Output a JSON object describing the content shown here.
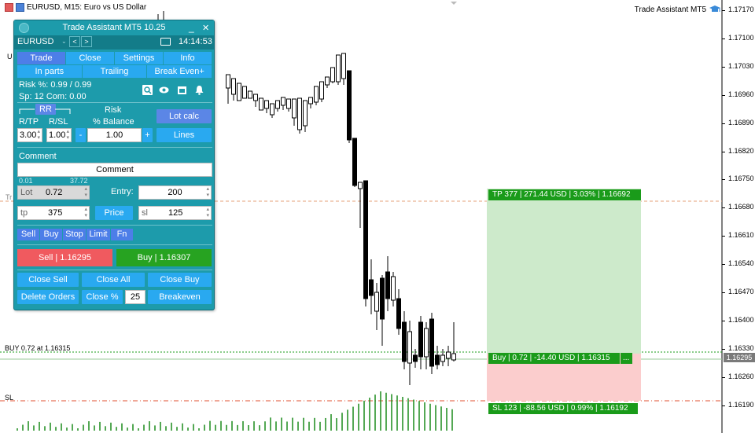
{
  "chart": {
    "symbol_title": "EURUSD, M15:  Euro vs US Dollar",
    "ea_name": "Trade Assistant MT5",
    "price_axis": [
      "1.17170",
      "1.17100",
      "1.17030",
      "1.16960",
      "1.16890",
      "1.16820",
      "1.16750",
      "1.16680",
      "1.16610",
      "1.16540",
      "1.16470",
      "1.16400",
      "1.16330",
      "1.16260",
      "1.16190"
    ],
    "current_price_tag": "1.16295",
    "buy_line_label": "BUY 0.72 at 1.16315",
    "sl_line_label": "SL",
    "tp_box_label": "TP 377 | 271.44 USD | 3.03% | 1.16692",
    "entry_box_label": "Buy | 0.72 | -14.40 USD | 1.16315",
    "entry_box_more": "...",
    "sl_box_label": "SL 123 | -88.56 USD | 0.99% | 1.16192",
    "left_marker_1": "U",
    "left_marker_2": "Tr",
    "colors": {
      "tp_zone": "#cdeacb",
      "sl_zone": "#fbcdcd",
      "label_bg": "#1a9b1a",
      "volume": "#1a8a1a",
      "grid": "#000000"
    }
  },
  "panel": {
    "title": "Trade Assistant MT5 10.25",
    "minimize": "_",
    "close": "✕",
    "symbol": "EURUSD",
    "symbol_dropdown": "⌄",
    "prev": "<",
    "next": ">",
    "time": "14:14:53",
    "tabs1": [
      "Trade",
      "Close",
      "Settings",
      "Info"
    ],
    "tabs2": [
      "In parts",
      "Trailing",
      "Break Even+"
    ],
    "risk_line": "Risk %: 0.99 /  0.99",
    "sp_line": "Sp: 12  Com: 0.00",
    "rr_label": "RR",
    "rtp_label": "R/TP",
    "rsl_label": "R/SL",
    "risk_label": "Risk",
    "balance_label": "% Balance",
    "lot_calc": "Lot calc",
    "rtp_value": "3.00",
    "rsl_value": "1.00",
    "minus": "-",
    "plus": "+",
    "risk_value": "1.00",
    "lines": "Lines",
    "comment_label": "Comment",
    "comment_value": "Comment",
    "lot_min": "0.01",
    "lot_max": "37.72",
    "lot_label": "Lot",
    "lot_value": "0.72",
    "entry_label": "Entry:",
    "entry_value": "200",
    "tp_label": "tp",
    "tp_value": "375",
    "price_btn": "Price",
    "sl_label": "sl",
    "sl_value": "125",
    "order_types": [
      "Sell",
      "Buy",
      "Stop",
      "Limit",
      "Fn"
    ],
    "sell_btn": "Sell  | 1.16295",
    "buy_btn": "Buy  | 1.16307",
    "close_sell": "Close Sell",
    "close_all": "Close All",
    "close_buy": "Close Buy",
    "delete_orders": "Delete Orders",
    "close_pct": "Close %",
    "close_pct_value": "25",
    "breakeven": "Breakeven"
  }
}
